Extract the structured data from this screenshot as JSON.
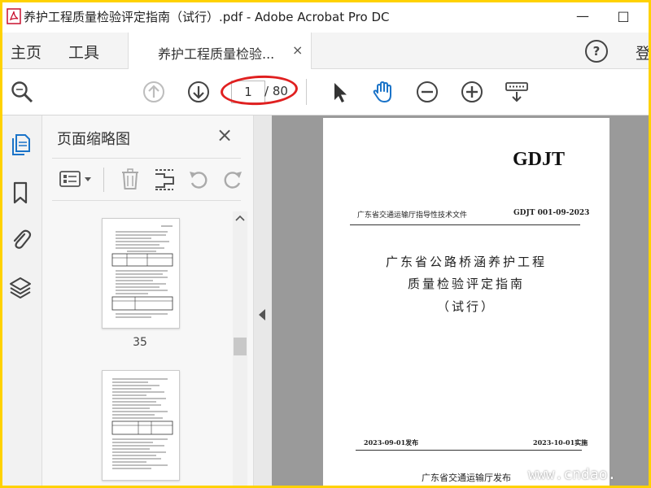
{
  "window": {
    "title": "养护工程质量检验评定指南（试行）.pdf - Adobe Acrobat Pro DC",
    "minimize": "—",
    "restore": "□"
  },
  "tabs": {
    "home": "主页",
    "tools": "工具",
    "doc_tab": "养护工程质量检验...",
    "doc_tab_close": "×",
    "help": "?",
    "login": "登"
  },
  "toolbar": {
    "page_current": "1",
    "page_total": "/ 80"
  },
  "panel": {
    "title": "页面缩略图",
    "close": "×",
    "thumbnails": [
      {
        "page_label": "35"
      },
      {
        "page_label": ""
      }
    ]
  },
  "document": {
    "code": "GDJT",
    "header_left": "广东省交通运输厅指导性技术文件",
    "header_right": "GDJT 001-09-2023",
    "title_line1": "广东省公路桥涵养护工程",
    "title_line2": "质量检验评定指南",
    "title_line3": "（试行）",
    "date_issued": "2023-09-01发布",
    "date_effective": "2023-10-01实施",
    "publisher": "广东省交通运输厅发布"
  },
  "watermark": "www.cndao.",
  "colors": {
    "frame": "#ffd200",
    "highlight_circle": "#e02020",
    "hand_tool_active": "#1a73c8",
    "rail_active": "#1a73c8"
  }
}
